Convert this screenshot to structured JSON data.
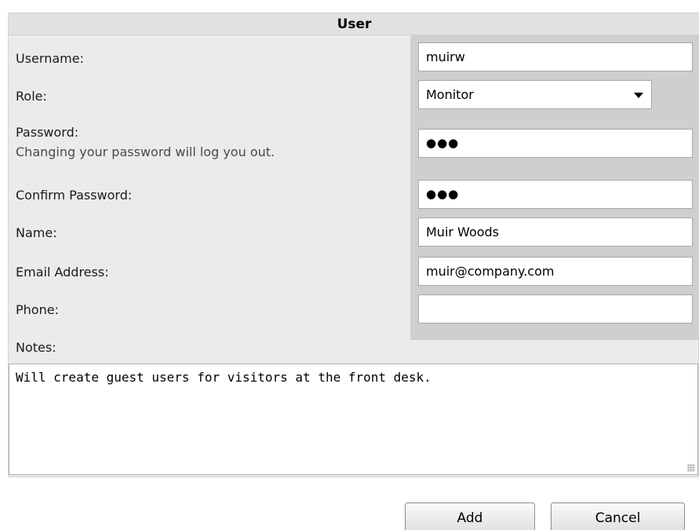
{
  "panel": {
    "title": "User"
  },
  "fields": {
    "username": {
      "label": "Username:",
      "value": "muirw"
    },
    "role": {
      "label": "Role:",
      "value": "Monitor"
    },
    "password": {
      "label": "Password:",
      "hint": "Changing your password will log you out.",
      "value": "●●●"
    },
    "confirm_password": {
      "label": "Confirm Password:",
      "value": "●●●"
    },
    "name": {
      "label": "Name:",
      "value": "Muir Woods"
    },
    "email": {
      "label": "Email Address:",
      "value": "muir@company.com"
    },
    "phone": {
      "label": "Phone:",
      "value": ""
    },
    "notes": {
      "label": "Notes:",
      "value": "Will create guest users for visitors at the front desk."
    }
  },
  "buttons": {
    "add": "Add",
    "cancel": "Cancel"
  }
}
